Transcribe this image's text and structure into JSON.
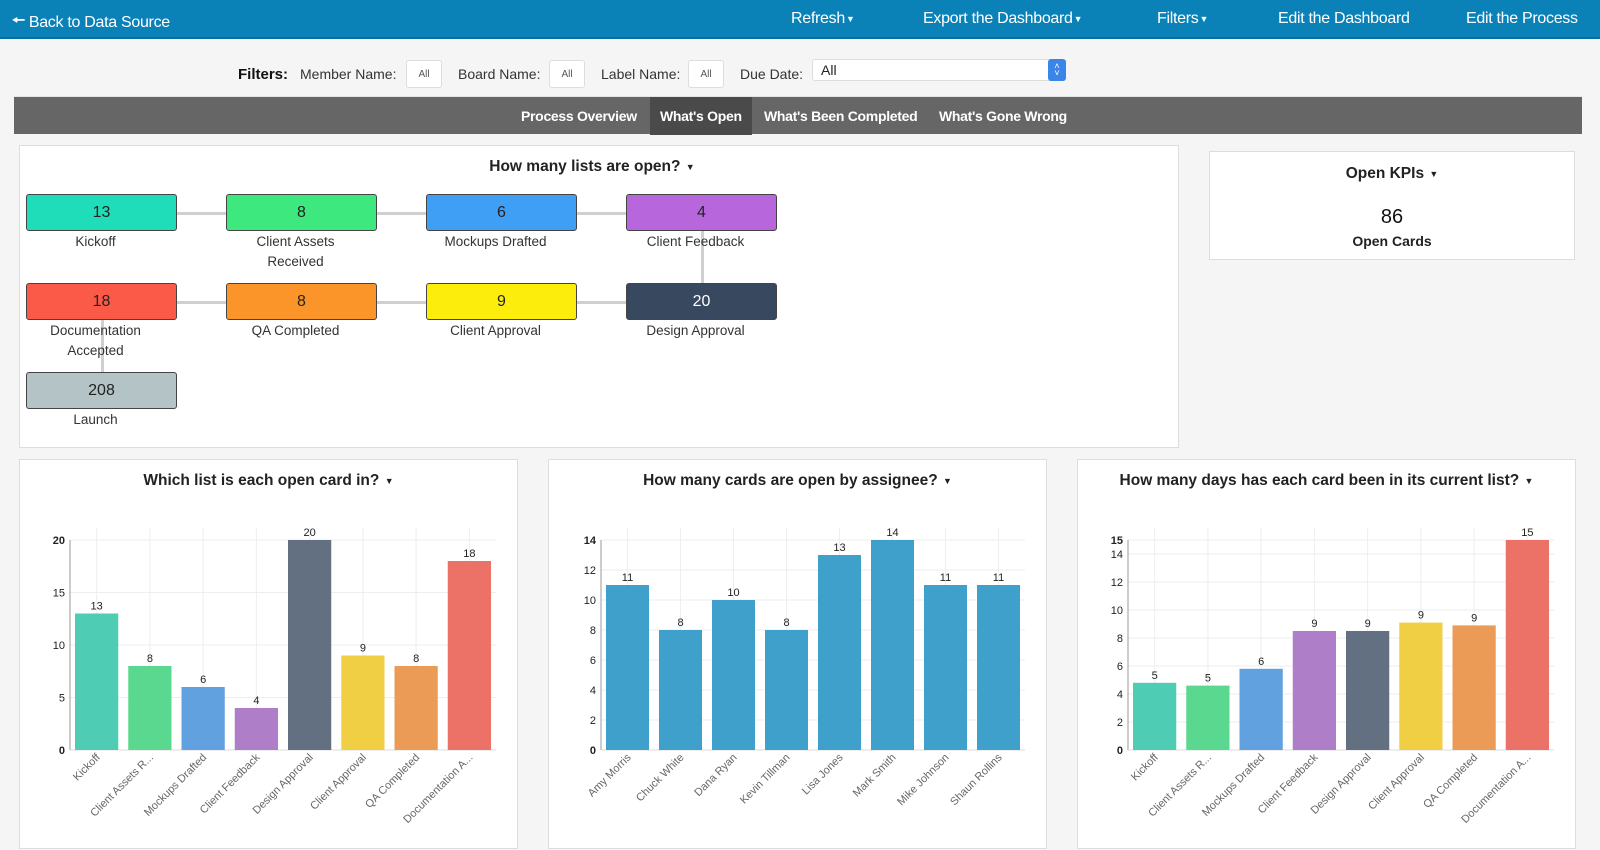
{
  "topbar": {
    "back_label": "Back to Data Source",
    "refresh_label": "Refresh",
    "export_label": "Export the Dashboard",
    "filters_label": "Filters",
    "edit_dashboard_label": "Edit the Dashboard",
    "edit_process_label": "Edit the Process",
    "color": "#0a82b8"
  },
  "filters": {
    "title": "Filters:",
    "member_label": "Member Name:",
    "member_value": "All",
    "board_label": "Board Name:",
    "board_value": "All",
    "label_label": "Label Name:",
    "label_value": "All",
    "due_label": "Due Date:",
    "due_value": "All"
  },
  "tabs": [
    {
      "label": "Process Overview",
      "active": false
    },
    {
      "label": "What's Open",
      "active": true
    },
    {
      "label": "What's Been Completed",
      "active": false
    },
    {
      "label": "What's Gone Wrong",
      "active": false
    }
  ],
  "process": {
    "title": "How many lists are open?",
    "nodes": [
      {
        "count": "13",
        "label": "Kickoff",
        "label2": "",
        "color": "#1fddb9",
        "text": "#222"
      },
      {
        "count": "8",
        "label": "Client Assets",
        "label2": "Received",
        "color": "#3de97f",
        "text": "#222"
      },
      {
        "count": "6",
        "label": "Mockups Drafted",
        "label2": "",
        "color": "#3e9ff5",
        "text": "#222"
      },
      {
        "count": "4",
        "label": "Client Feedback",
        "label2": "",
        "color": "#b866dc",
        "text": "#222"
      },
      {
        "count": "18",
        "label": "Documentation",
        "label2": "Accepted",
        "color": "#fc5a48",
        "text": "#222"
      },
      {
        "count": "8",
        "label": "QA Completed",
        "label2": "",
        "color": "#fc9529",
        "text": "#222"
      },
      {
        "count": "9",
        "label": "Client Approval",
        "label2": "",
        "color": "#fced0d",
        "text": "#222"
      },
      {
        "count": "20",
        "label": "Design Approval",
        "label2": "",
        "color": "#38495f",
        "text": "#fff"
      },
      {
        "count": "208",
        "label": "Launch",
        "label2": "",
        "color": "#b3c3c6",
        "text": "#222"
      }
    ]
  },
  "kpi": {
    "title": "Open KPIs",
    "value": "86",
    "label": "Open Cards"
  },
  "chart_data": [
    {
      "type": "bar",
      "title": "Which list is each open card in?",
      "categories": [
        "Kickoff",
        "Client Assets R...",
        "Mockups Drafted",
        "Client Feedback",
        "Design Approval",
        "Client Approval",
        "QA Completed",
        "Documentation A..."
      ],
      "values": [
        13,
        8,
        6,
        4,
        20,
        9,
        8,
        18
      ],
      "labels": [
        "13",
        "8",
        "6",
        "4",
        "20",
        "9",
        "8",
        "18"
      ],
      "colors": [
        "#4ecdb4",
        "#5bd88f",
        "#62a1e0",
        "#ae7fc8",
        "#637082",
        "#f1cf45",
        "#eb9b55",
        "#ec7167"
      ],
      "yticks": [
        0,
        5,
        10,
        15,
        20
      ],
      "ylim": [
        0,
        20
      ],
      "xlabel": "",
      "ylabel": "",
      "grid": true
    },
    {
      "type": "bar",
      "title": "How many cards are open by assignee?",
      "categories": [
        "Amy Morris",
        "Chuck White",
        "Dana Ryan",
        "Kevin Tillman",
        "Lisa Jones",
        "Mark Smith",
        "Mike Johnson",
        "Shaun Rollins"
      ],
      "values": [
        11,
        8,
        10,
        8,
        13,
        14,
        11,
        11
      ],
      "labels": [
        "11",
        "8",
        "10",
        "8",
        "13",
        "14",
        "11",
        "11"
      ],
      "colors": [
        "#3ea0cb",
        "#3ea0cb",
        "#3ea0cb",
        "#3ea0cb",
        "#3ea0cb",
        "#3ea0cb",
        "#3ea0cb",
        "#3ea0cb"
      ],
      "yticks": [
        0,
        2,
        4,
        6,
        8,
        10,
        12,
        14
      ],
      "ylim": [
        0,
        14
      ],
      "xlabel": "",
      "ylabel": "",
      "grid": true
    },
    {
      "type": "bar",
      "title": "How many days has each card been in its current list?",
      "categories": [
        "Kickoff",
        "Client Assets R...",
        "Mockups Drafted",
        "Client Feedback",
        "Design Approval",
        "Client Approval",
        "QA Completed",
        "Documentation A..."
      ],
      "values": [
        4.8,
        4.6,
        5.8,
        8.5,
        8.5,
        9.1,
        8.9,
        15
      ],
      "labels": [
        "5",
        "5",
        "6",
        "9",
        "9",
        "9",
        "9",
        "15"
      ],
      "colors": [
        "#4ecdb4",
        "#5bd88f",
        "#62a1e0",
        "#ae7fc8",
        "#637082",
        "#f1cf45",
        "#eb9b55",
        "#ec7167"
      ],
      "yticks": [
        0,
        2,
        4,
        6,
        8,
        10,
        12,
        14,
        15
      ],
      "ylim": [
        0,
        15
      ],
      "xlabel": "",
      "ylabel": "",
      "grid": true
    }
  ]
}
